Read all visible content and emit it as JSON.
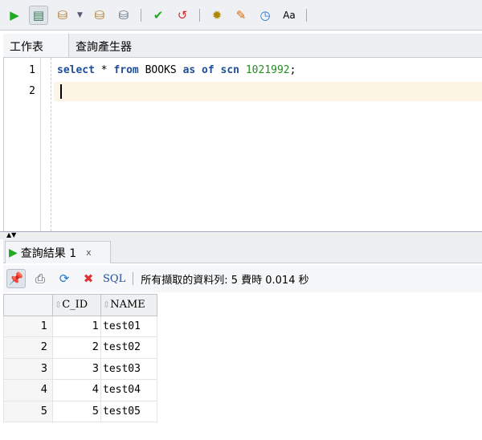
{
  "toolbar": {
    "icons": [
      "run-statement-icon",
      "run-script-icon",
      "autotrace-icon",
      "explain-plan-icon",
      "sql-tuning-icon",
      "commit-icon",
      "rollback-icon",
      "sql-history-icon",
      "clear-icon",
      "monitor-icon",
      "format-case-icon"
    ]
  },
  "tabs": [
    "工作表",
    "查詢產生器"
  ],
  "editor": {
    "line_numbers": [
      "1",
      "2"
    ],
    "code": {
      "k1": "select",
      "t1": " * ",
      "k2": "from",
      "t2": " BOOKS ",
      "k3": "as",
      "t3": " ",
      "k4": "of",
      "t4": " ",
      "k5": "scn",
      "t5": " ",
      "n": "1021992",
      "t6": ";"
    }
  },
  "result_tab": {
    "label": "查詢結果 1",
    "close": "x"
  },
  "result_toolbar": {
    "sql_label": "SQL",
    "status": "所有擷取的資料列: 5 費時 0.014 秒"
  },
  "grid": {
    "columns": [
      "C_ID",
      "NAME"
    ],
    "rows": [
      {
        "n": "1",
        "c_id": "1",
        "name": "test01"
      },
      {
        "n": "2",
        "c_id": "2",
        "name": "test02"
      },
      {
        "n": "3",
        "c_id": "3",
        "name": "test03"
      },
      {
        "n": "4",
        "c_id": "4",
        "name": "test04"
      },
      {
        "n": "5",
        "c_id": "5",
        "name": "test05"
      }
    ]
  }
}
